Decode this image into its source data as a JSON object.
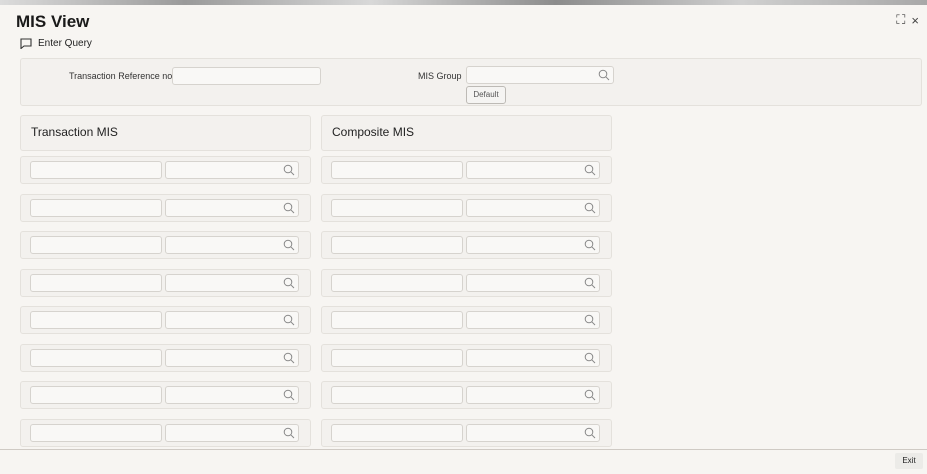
{
  "window": {
    "title": "MIS View",
    "enter_query_label": "Enter Query",
    "expand_icon": "⛶",
    "close_icon": "×"
  },
  "header_form": {
    "txn_ref_label": "Transaction Reference no",
    "txn_ref_value": "",
    "required_mark": "*",
    "mis_group_label": "MIS Group",
    "mis_group_value": "",
    "default_button": "Default"
  },
  "transaction_mis": {
    "title": "Transaction MIS",
    "rows": [
      {
        "code": "",
        "value": ""
      },
      {
        "code": "",
        "value": ""
      },
      {
        "code": "",
        "value": ""
      },
      {
        "code": "",
        "value": ""
      },
      {
        "code": "",
        "value": ""
      },
      {
        "code": "",
        "value": ""
      },
      {
        "code": "",
        "value": ""
      },
      {
        "code": "",
        "value": ""
      }
    ]
  },
  "composite_mis": {
    "title": "Composite MIS",
    "rows": [
      {
        "code": "",
        "value": ""
      },
      {
        "code": "",
        "value": ""
      },
      {
        "code": "",
        "value": ""
      },
      {
        "code": "",
        "value": ""
      },
      {
        "code": "",
        "value": ""
      },
      {
        "code": "",
        "value": ""
      },
      {
        "code": "",
        "value": ""
      },
      {
        "code": "",
        "value": ""
      }
    ]
  },
  "footer": {
    "exit_button": "Exit"
  },
  "colors": {
    "background": "#f7f5f2",
    "panel": "#f3f1ee",
    "border": "#d6d3ce",
    "required": "#c0392b"
  }
}
